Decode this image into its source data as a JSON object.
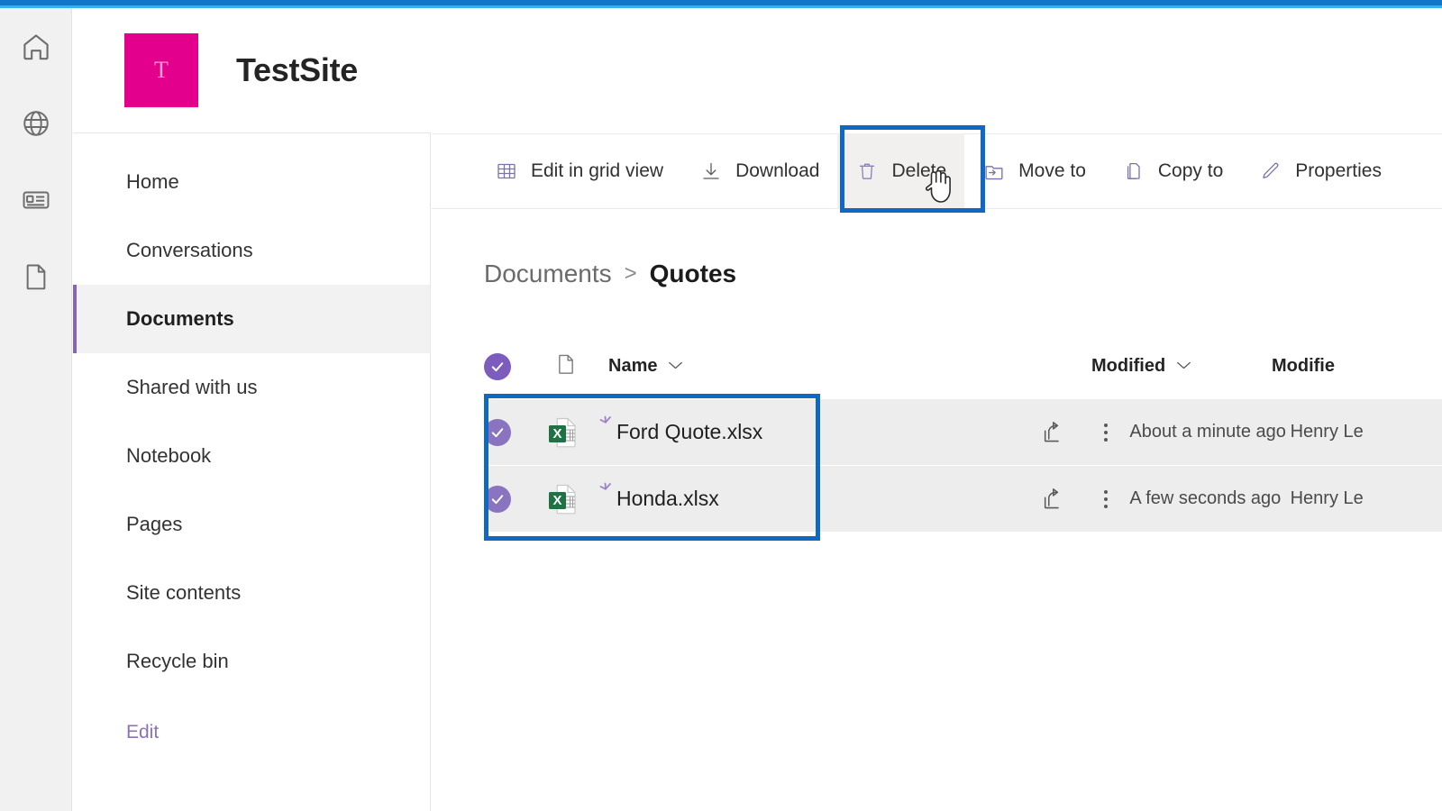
{
  "theme": {
    "browser_bar": "#1277c9",
    "browser_accent": "#34b2ee",
    "site_logo_bg": "#e3008c",
    "accent_purple": "#8764b8",
    "selection_purple": "#8a74c0",
    "annotation_blue": "#1168c3",
    "row_bg": "#ededed",
    "excel_green": "#1f7244"
  },
  "rail": {
    "items": [
      {
        "name": "home-icon",
        "label": "Home"
      },
      {
        "name": "globe-icon",
        "label": "My sites"
      },
      {
        "name": "news-icon",
        "label": "News"
      },
      {
        "name": "document-icon",
        "label": "Files"
      }
    ]
  },
  "site_header": {
    "logo_letter": "T",
    "title": "TestSite"
  },
  "nav": {
    "items": [
      {
        "label": "Home",
        "selected": false
      },
      {
        "label": "Conversations",
        "selected": false
      },
      {
        "label": "Documents",
        "selected": true
      },
      {
        "label": "Shared with us",
        "selected": false
      },
      {
        "label": "Notebook",
        "selected": false
      },
      {
        "label": "Pages",
        "selected": false
      },
      {
        "label": "Site contents",
        "selected": false
      },
      {
        "label": "Recycle bin",
        "selected": false
      }
    ],
    "edit_label": "Edit"
  },
  "commandbar": {
    "items": [
      {
        "label": "Edit in grid view",
        "icon": "grid-icon",
        "active": false
      },
      {
        "label": "Download",
        "icon": "download-icon",
        "active": false
      },
      {
        "label": "Delete",
        "icon": "trash-icon",
        "active": true
      },
      {
        "label": "Move to",
        "icon": "move-to-icon",
        "active": false
      },
      {
        "label": "Copy to",
        "icon": "copy-to-icon",
        "active": false
      },
      {
        "label": "Properties",
        "icon": "pencil-icon",
        "active": false
      }
    ]
  },
  "breadcrumb": {
    "root": "Documents",
    "separator": ">",
    "current": "Quotes"
  },
  "list": {
    "headers": {
      "name": "Name",
      "modified": "Modified",
      "modified_by": "Modifie"
    },
    "rows": [
      {
        "name": "Ford Quote.xlsx",
        "file_type": "xlsx",
        "is_new": true,
        "selected": true,
        "modified": "About a minute ago",
        "modified_by": "Henry Le"
      },
      {
        "name": "Honda.xlsx",
        "file_type": "xlsx",
        "is_new": true,
        "selected": true,
        "modified": "A few seconds ago",
        "modified_by": "Henry Le"
      }
    ]
  }
}
